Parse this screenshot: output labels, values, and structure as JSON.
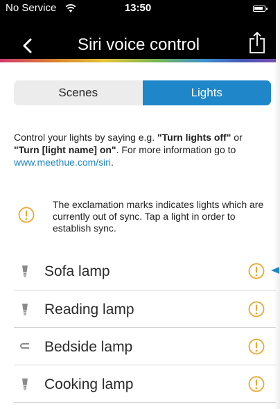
{
  "status_bar": {
    "carrier": "No Service",
    "time": "13:50"
  },
  "nav": {
    "title": "Siri voice control"
  },
  "segmented": {
    "scenes": "Scenes",
    "lights": "Lights"
  },
  "intro": {
    "part1": "Control your lights by saying e.g. ",
    "bold1": "\"Turn lights off\"",
    "part2": " or ",
    "bold2": "\"Turn [light name] on\"",
    "part3": ". For more information go to ",
    "link": "www.meethue.com/siri",
    "part4": "."
  },
  "notice": {
    "text": "The exclamation marks indicates lights which are currently out of sync. Tap a light in order to establish sync."
  },
  "lights": [
    {
      "name": "Sofa lamp",
      "icon": "bulb-icon"
    },
    {
      "name": "Reading lamp",
      "icon": "bulb-icon"
    },
    {
      "name": "Bedside lamp",
      "icon": "lightstrip-icon"
    },
    {
      "name": "Cooking lamp",
      "icon": "bulb-icon"
    }
  ],
  "colors": {
    "accent": "#1f87c9",
    "warning": "#f0a52e",
    "header": "#000000"
  }
}
